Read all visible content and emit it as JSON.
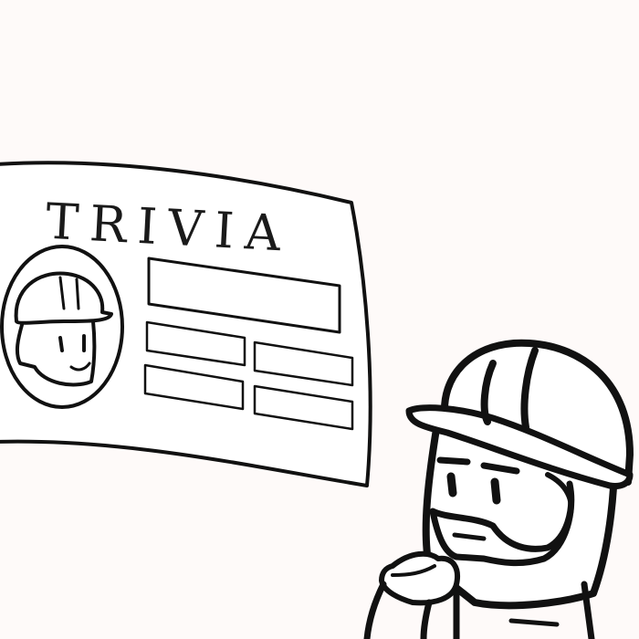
{
  "banner": {
    "title": "TRIVIA"
  },
  "colors": {
    "background": "#fefaf9",
    "ink": "#111111",
    "paper": "#ffffff"
  }
}
